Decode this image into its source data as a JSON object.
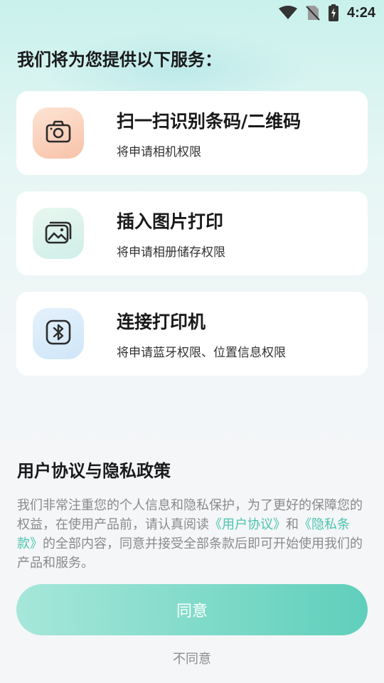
{
  "status_bar": {
    "time": "4:24",
    "icons": [
      "wifi-icon",
      "no-sim-icon",
      "battery-charging-icon"
    ]
  },
  "intro": {
    "title": "我们将为您提供以下服务："
  },
  "services": [
    {
      "icon": "camera-icon",
      "title": "扫一扫识别条码/二维码",
      "desc": "将申请相机权限"
    },
    {
      "icon": "image-icon",
      "title": "插入图片打印",
      "desc": "将申请相册储存权限"
    },
    {
      "icon": "bluetooth-icon",
      "title": "连接打印机",
      "desc": "将申请蓝牙权限、位置信息权限"
    }
  ],
  "policy": {
    "title": "用户协议与隐私政策",
    "text_1": "我们非常注重您的个人信息和隐私保护，为了更好的保障您的权益，在使用产品前，请认真阅读",
    "link_user_agreement": "《用户协议》",
    "text_and": "和",
    "link_privacy": "《隐私条款》",
    "text_2": "的全部内容，同意并接受全部条款后即可开始使用我们的产品和服务。"
  },
  "buttons": {
    "agree": "同意",
    "disagree": "不同意"
  },
  "colors": {
    "accent": "#4cc4b0",
    "button_start": "#a6e7da",
    "button_end": "#5fcfbb"
  }
}
